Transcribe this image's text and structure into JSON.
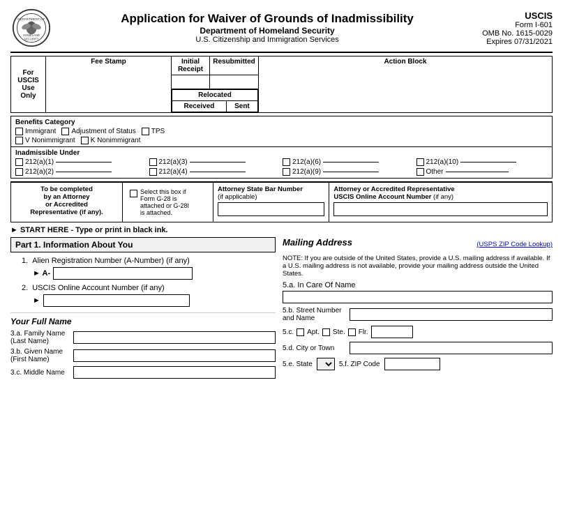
{
  "header": {
    "title": "Application for Waiver of Grounds of Inadmissibility",
    "sub1": "Department of Homeland Security",
    "sub2": "U.S. Citizenship and Immigration Services",
    "form_label": "USCIS",
    "form_number": "Form I-601",
    "omb": "OMB No. 1615-0029",
    "expires": "Expires 07/31/2021"
  },
  "fee_table": {
    "for_uscis": "For\nUSCIS\nUse\nOnly",
    "fee_stamp": "Fee Stamp",
    "initial_receipt": "Initial\nReceipt",
    "resubmitted": "Resubmitted",
    "action_block": "Action Block",
    "relocated": "Relocated",
    "received": "Received",
    "sent": "Sent"
  },
  "benefits": {
    "label": "Benefits Category",
    "items": [
      "Immigrant",
      "Adjustment of Status",
      "TPS",
      "V Nonimmigrant",
      "K Nonimmigrant"
    ]
  },
  "inadmissible": {
    "label": "Inadmissible Under",
    "items": [
      "212(a)(1)",
      "212(a)(3)",
      "212(a)(6)",
      "212(a)(10)",
      "212(a)(2)",
      "212(a)(4)",
      "212(a)(9)",
      "Other"
    ]
  },
  "attorney": {
    "col1_label": "To be completed\nby an Attorney\nor Accredited\nRepresentative (if any).",
    "col2_text": "Select this box if\nForm G-28 is\nattached or G-28I\nis attached.",
    "col3_label": "Attorney State Bar Number\n(if applicable)",
    "col4_label": "Attorney or Accredited Representative\nUSCIS Online Account Number (if any)"
  },
  "start_here": "► START HERE - Type or print in black ink.",
  "part1": {
    "label": "Part 1.  Information About You",
    "field1_label": "Alien Registration Number (A-Number) (if any)",
    "field1_prefix": "► A-",
    "field2_label": "USCIS Online Account Number (if any)",
    "field2_arrow": "►",
    "your_full_name": "Your Full Name",
    "field3a_label": "3.a.",
    "field3a_name": "Family Name\n(Last Name)",
    "field3b_label": "3.b.",
    "field3b_name": "Given Name\n(First Name)",
    "field3c_label": "3.c.",
    "field3c_name": "Middle Name"
  },
  "mailing": {
    "label": "Mailing Address",
    "usps_link": "(USPS ZIP Code Lookup)",
    "note": "NOTE: If you are outside of the United States, provide a U.S. mailing address if available. If a U.S. mailing address is not available, provide your mailing address outside the United States.",
    "field5a_label": "5.a.",
    "field5a_name": "In Care Of Name",
    "field5b_label": "5.b.",
    "field5b_name": "Street Number\nand Name",
    "field5c_label": "5.c.",
    "apt_label": "Apt.",
    "ste_label": "Ste.",
    "flr_label": "Flr.",
    "field5d_label": "5.d.",
    "field5d_name": "City or Town",
    "field5e_label": "5.e.",
    "field5e_name": "State",
    "field5f_label": "5.f.",
    "field5f_name": "ZIP Code"
  }
}
